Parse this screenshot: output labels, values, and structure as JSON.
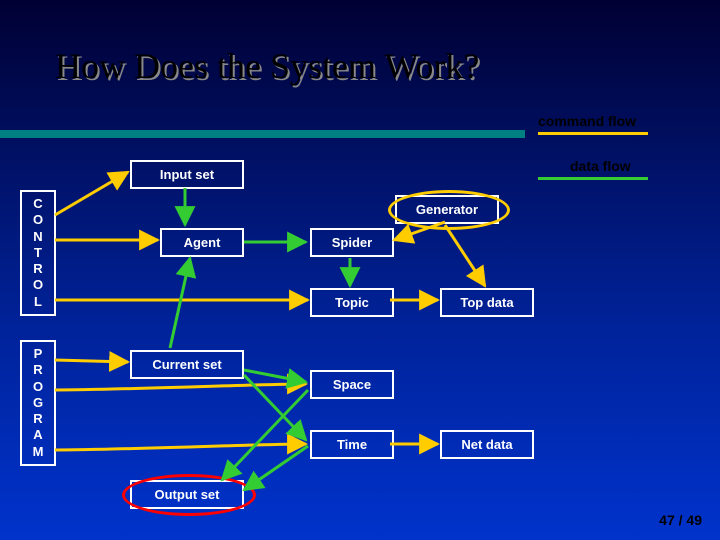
{
  "title": "How Does the System Work?",
  "legend": {
    "command": "command flow",
    "data": "data flow"
  },
  "sidebar": {
    "top": "C\nO\nN\nT\nR\nO\nL",
    "bottom": "P\nR\nO\nG\nR\nA\nM"
  },
  "nodes": {
    "input_set": "Input set",
    "agent": "Agent",
    "generator": "Generator",
    "spider": "Spider",
    "topic": "Topic",
    "top_data": "Top data",
    "current_set": "Current set",
    "space": "Space",
    "time": "Time",
    "net_data": "Net data",
    "output_set": "Output set"
  },
  "page": "47 / 49",
  "colors": {
    "command": "#ffcc00",
    "data": "#33cc33",
    "rule": "#008080",
    "oval_output": "#ff0000",
    "oval_generator": "#ffcc00"
  }
}
